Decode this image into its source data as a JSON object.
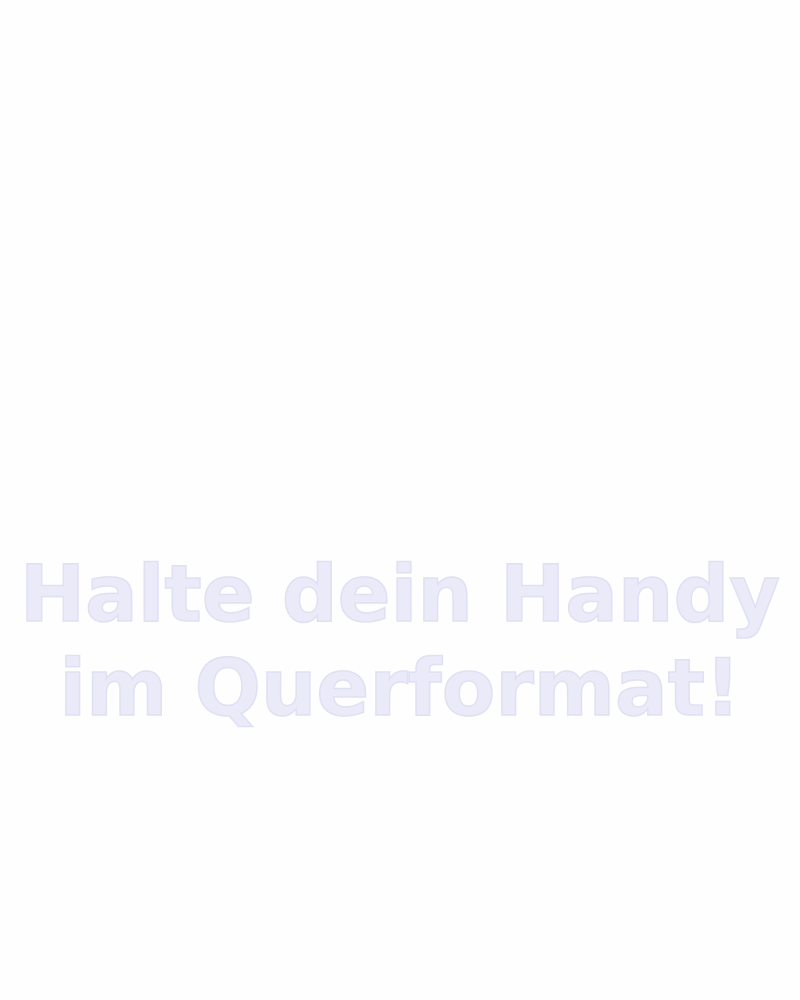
{
  "message": {
    "line1": "Halte dein Handy",
    "line2": "im Querformat!"
  },
  "colors": {
    "background": "#fefefe",
    "text": "#eaeaf9"
  }
}
